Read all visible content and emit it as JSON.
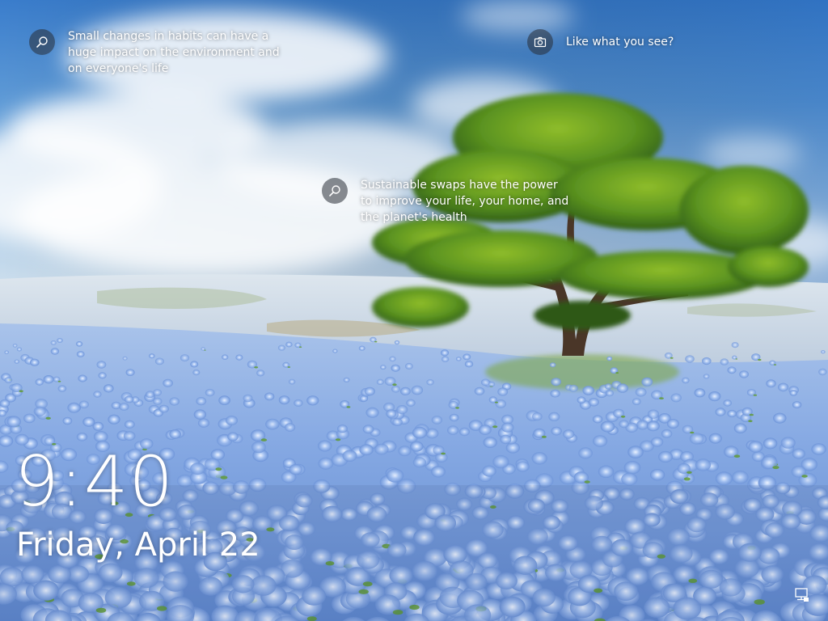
{
  "lockscreen": {
    "time": "9:40",
    "date": "Friday, April 22",
    "hotspots": [
      {
        "icon": "search-icon",
        "text": "Small changes in habits can have a huge impact on the environment and on everyone's life"
      },
      {
        "icon": "camera-icon",
        "text": "Like what you see?"
      },
      {
        "icon": "search-icon",
        "text": "Sustainable swaps have the power to improve your life, your home, and the planet's health"
      }
    ],
    "status_icon": "network-icon"
  },
  "colors": {
    "text": "#ffffff",
    "sky_top": "#3a7fd0",
    "sky_light": "#a9cce8",
    "flower_blue": "#8fb3ea",
    "tree_green": "#4f8a1c",
    "icon_bg": "#2c313a"
  }
}
